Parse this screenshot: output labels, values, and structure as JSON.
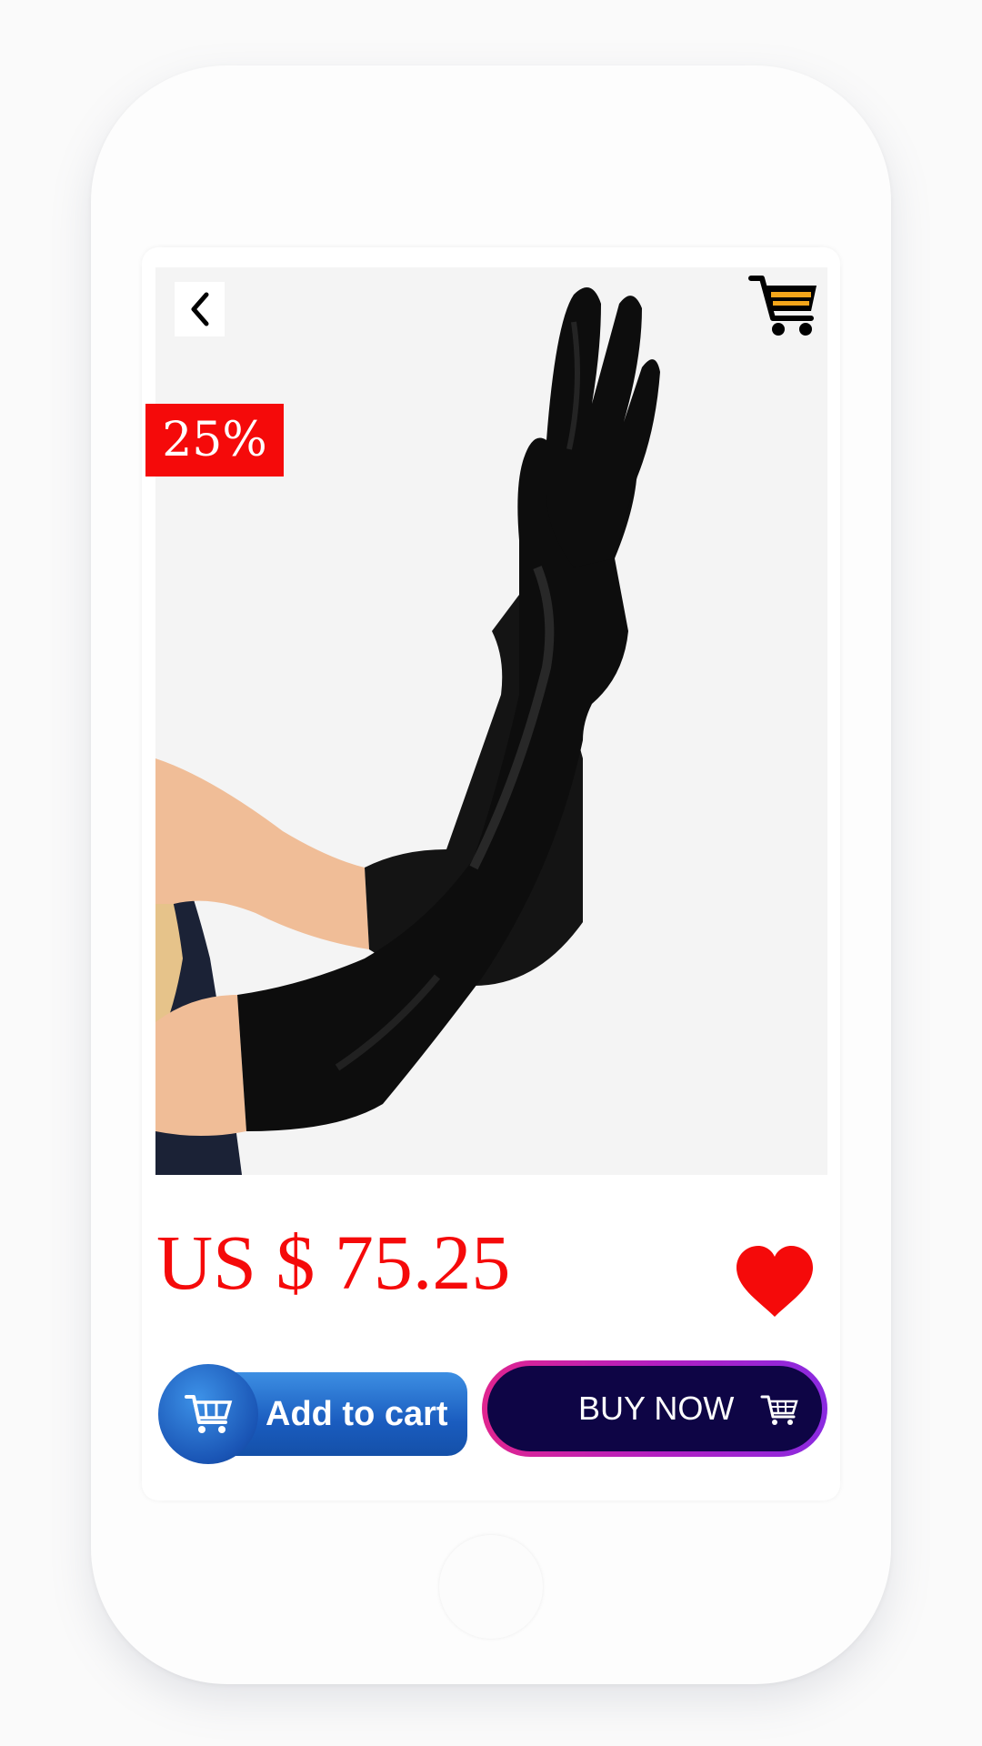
{
  "product": {
    "discount_badge": "25%",
    "price": "US $ 75.25",
    "image_icon": "product-photo-black-satin-gloves"
  },
  "actions": {
    "add_to_cart_label": "Add to cart",
    "buy_now_label": "BUY NOW"
  },
  "icons": {
    "back": "chevron-left-icon",
    "cart": "shopping-cart-icon",
    "wishlist": "heart-icon"
  },
  "colors": {
    "price_red": "#f50a0a",
    "badge_red": "#f50a0a",
    "heart_red": "#f50a0a",
    "add_to_cart_blue": "#1a5cbf",
    "buy_now_navy": "#0e0545",
    "buy_now_border": "#c01fbf",
    "image_background": "#f4f4f4"
  }
}
